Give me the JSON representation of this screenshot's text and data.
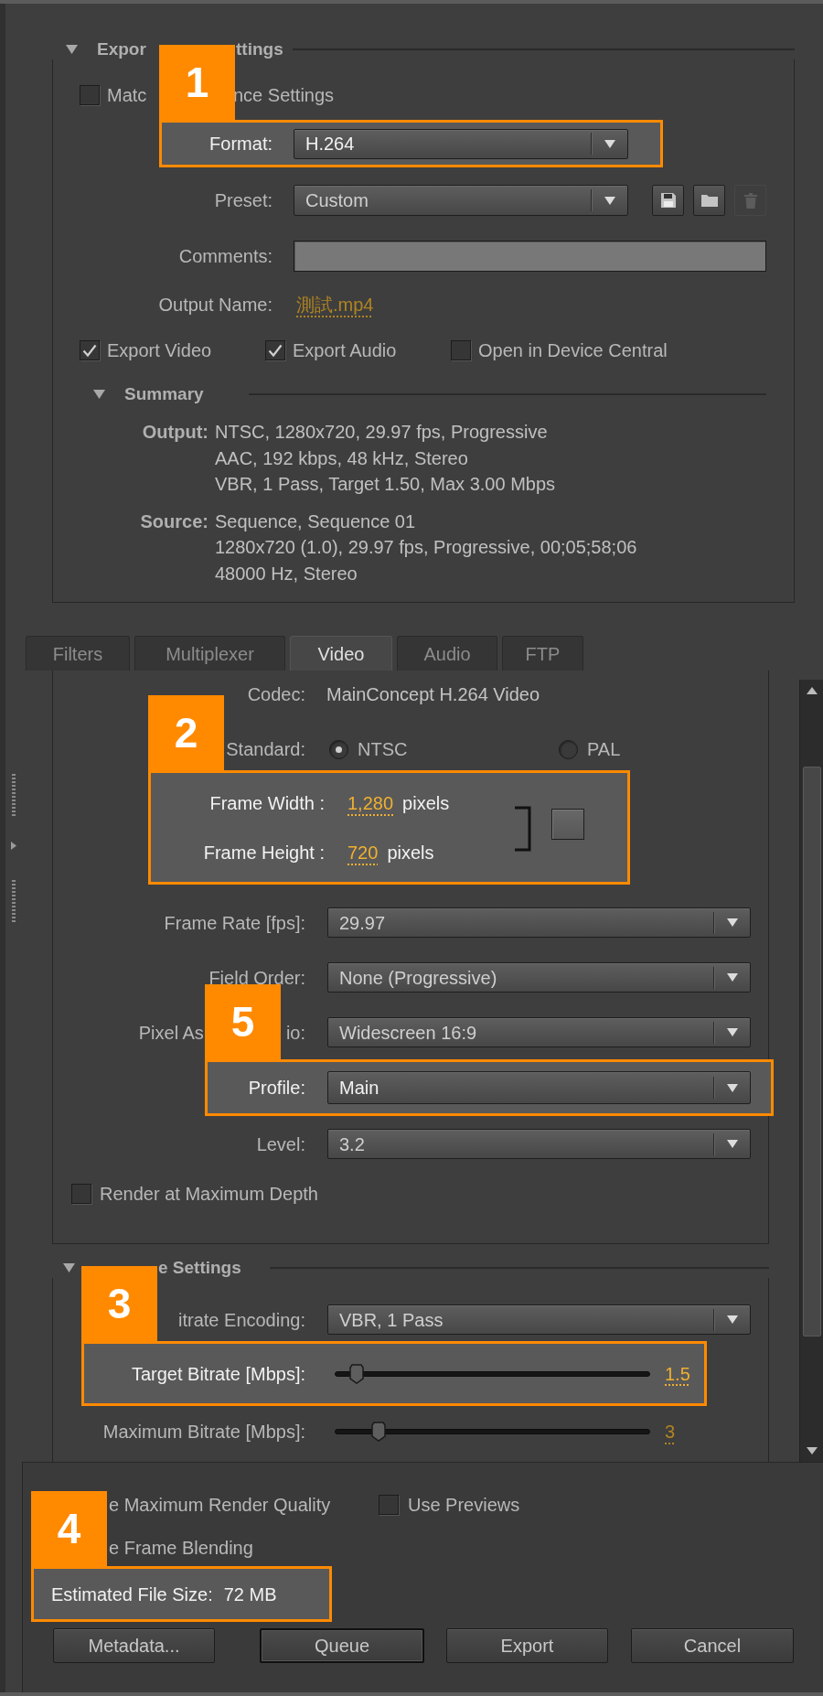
{
  "export_settings": {
    "title_fragments": [
      "Expor",
      "ttings"
    ],
    "expanded": true,
    "match_settings": {
      "label_fragments": [
        "Matc",
        "nce Settings"
      ],
      "checked": false
    },
    "format": {
      "label": "Format:",
      "value": "H.264",
      "callout": "1"
    },
    "preset": {
      "label": "Preset:",
      "value": "Custom",
      "actions": [
        {
          "kind": "save",
          "disabled": false
        },
        {
          "kind": "open",
          "disabled": false
        },
        {
          "kind": "delete",
          "disabled": true
        }
      ]
    },
    "comments": {
      "label": "Comments:"
    },
    "output_name": {
      "label": "Output Name:",
      "value": "測試.mp4"
    },
    "export_options": [
      {
        "label": "Export Video",
        "checked": true
      },
      {
        "label": "Export Audio",
        "checked": true
      },
      {
        "label": "Open in Device Central",
        "checked": false
      }
    ],
    "summary": {
      "title": "Summary",
      "expanded": true,
      "entries": [
        {
          "label": "Output:",
          "lines": [
            "NTSC, 1280x720, 29.97 fps, Progressive",
            "AAC, 192 kbps, 48 kHz, Stereo",
            "VBR, 1 Pass, Target 1.50, Max 3.00 Mbps"
          ]
        },
        {
          "label": "Source:",
          "lines": [
            "Sequence, Sequence 01",
            "1280x720 (1.0), 29.97 fps, Progressive, 00;05;58;06",
            "48000 Hz, Stereo"
          ]
        }
      ]
    }
  },
  "tabs": [
    {
      "label": "Filters",
      "selected": false
    },
    {
      "label": "Multiplexer",
      "selected": false
    },
    {
      "label": "Video",
      "selected": true
    },
    {
      "label": "Audio",
      "selected": false
    },
    {
      "label": "FTP",
      "selected": false
    }
  ],
  "video": {
    "codec": {
      "label": "Codec:",
      "value": "MainConcept H.264 Video"
    },
    "standard": {
      "label": "Standard:",
      "options": [
        {
          "label": "NTSC",
          "selected": true
        },
        {
          "label": "PAL",
          "selected": false
        }
      ]
    },
    "frame_size": {
      "callout": "2",
      "rows": [
        {
          "label": "Frame Width :",
          "value": "1,280",
          "unit": "pixels"
        },
        {
          "label": "Frame Height :",
          "value": "720",
          "unit": "pixels"
        }
      ]
    },
    "settings": [
      {
        "label_fragments": [
          "Frame Rate [fps]:"
        ],
        "value": "29.97"
      },
      {
        "label_fragments": [
          "Field Order:"
        ],
        "value": "None (Progressive)"
      },
      {
        "label_fragments": [
          "Pixel As",
          "io:"
        ],
        "value": "Widescreen 16:9"
      },
      {
        "label_fragments": [
          "Profile:"
        ],
        "value": "Main",
        "callout": "5"
      },
      {
        "label_fragments": [
          "Level:"
        ],
        "value": "3.2"
      }
    ],
    "render_at_maximum_depth": {
      "label": "Render at Maximum Depth",
      "checked": false
    }
  },
  "bitrate_settings": {
    "title": "e Settings",
    "expanded": true,
    "encoding": {
      "label": "itrate Encoding:",
      "value": "VBR, 1 Pass"
    },
    "sliders": [
      {
        "label": "Target Bitrate [Mbps]:",
        "level": 0.07,
        "value": "1.5",
        "callout": "3"
      },
      {
        "label": "Maximum Bitrate [Mbps]:",
        "level": 0.14,
        "value": "3"
      }
    ]
  },
  "render_options": [
    [
      {
        "kind": "text",
        "label": "e Maximum Render Quality"
      },
      {
        "kind": "checkbox",
        "label": "Use Previews",
        "checked": false
      }
    ],
    [
      {
        "kind": "text",
        "label": "e Frame Blending"
      }
    ]
  ],
  "estimated_file_size": {
    "label": "Estimated File Size:",
    "value": "72 MB",
    "callout": "4"
  },
  "buttons": [
    {
      "label": "Metadata...",
      "default": false
    },
    {
      "label": "Queue",
      "default": true
    },
    {
      "label": "Export",
      "default": false
    },
    {
      "label": "Cancel",
      "default": false
    }
  ]
}
